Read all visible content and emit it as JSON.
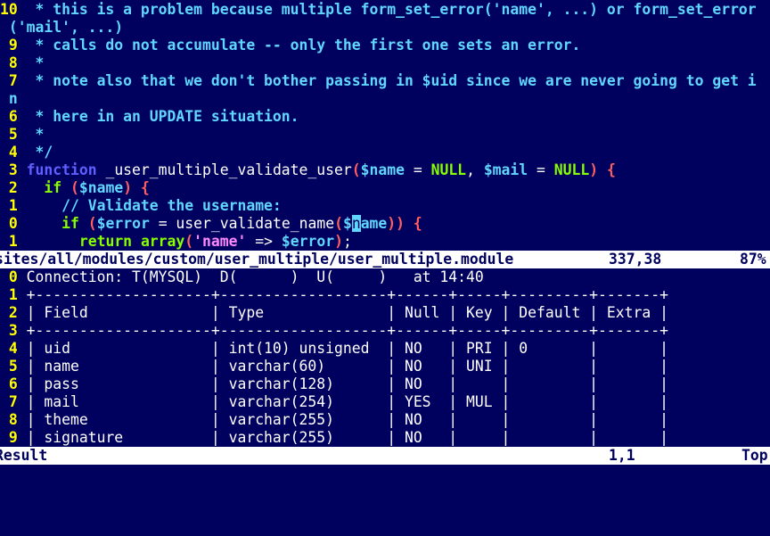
{
  "editor": {
    "lines": [
      {
        "ln": "10",
        "parts": [
          {
            "c": "cm",
            "t": " * this is a problem because multiple form_set_error('name', ...) or form_set_error"
          }
        ]
      },
      {
        "ln": "",
        "parts": [
          {
            "c": "cm",
            "t": "('mail', ...)"
          }
        ]
      },
      {
        "ln": " 9",
        "parts": [
          {
            "c": "cm",
            "t": " * calls do not accumulate -- only the first one sets an error."
          }
        ]
      },
      {
        "ln": " 8",
        "parts": [
          {
            "c": "cm",
            "t": " *"
          }
        ]
      },
      {
        "ln": " 7",
        "parts": [
          {
            "c": "cm",
            "t": " * note also that we don't bother passing in $uid since we are never going to get i"
          }
        ]
      },
      {
        "ln": "",
        "parts": [
          {
            "c": "cm",
            "t": "n"
          }
        ]
      },
      {
        "ln": " 6",
        "parts": [
          {
            "c": "cm",
            "t": " * here in an UPDATE situation."
          }
        ]
      },
      {
        "ln": " 5",
        "parts": [
          {
            "c": "cm",
            "t": " *"
          }
        ]
      },
      {
        "ln": " 4",
        "parts": [
          {
            "c": "cm",
            "t": " */"
          }
        ]
      },
      {
        "ln": " 3",
        "parts": [
          {
            "c": "kw",
            "t": "function"
          },
          {
            "c": "wht",
            "t": " _user_multiple_validate_user"
          },
          {
            "c": "red",
            "t": "("
          },
          {
            "c": "var",
            "t": "$name"
          },
          {
            "c": "wht",
            "t": " = "
          },
          {
            "c": "grn",
            "t": "NULL"
          },
          {
            "c": "wht",
            "t": ", "
          },
          {
            "c": "var",
            "t": "$mail"
          },
          {
            "c": "wht",
            "t": " = "
          },
          {
            "c": "grn",
            "t": "NULL"
          },
          {
            "c": "red",
            "t": ")"
          },
          {
            "c": "wht",
            "t": " "
          },
          {
            "c": "red",
            "t": "{"
          }
        ]
      },
      {
        "ln": " 2",
        "parts": [
          {
            "c": "wht",
            "t": "  "
          },
          {
            "c": "grn",
            "t": "if"
          },
          {
            "c": "wht",
            "t": " "
          },
          {
            "c": "red",
            "t": "("
          },
          {
            "c": "var",
            "t": "$name"
          },
          {
            "c": "red",
            "t": ")"
          },
          {
            "c": "wht",
            "t": " "
          },
          {
            "c": "red",
            "t": "{"
          }
        ]
      },
      {
        "ln": " 1",
        "parts": [
          {
            "c": "cm",
            "t": "    // Validate the username:"
          }
        ]
      },
      {
        "ln": " 0",
        "parts": [
          {
            "c": "wht",
            "t": "    "
          },
          {
            "c": "grn",
            "t": "if"
          },
          {
            "c": "wht",
            "t": " "
          },
          {
            "c": "red",
            "t": "("
          },
          {
            "c": "var",
            "t": "$error"
          },
          {
            "c": "wht",
            "t": " = user_validate_name"
          },
          {
            "c": "red",
            "t": "("
          },
          {
            "c": "var",
            "t": "$"
          },
          {
            "c": "cursor",
            "t": "n"
          },
          {
            "c": "var",
            "t": "ame"
          },
          {
            "c": "red",
            "t": "))"
          },
          {
            "c": "wht",
            "t": " "
          },
          {
            "c": "red",
            "t": "{"
          }
        ]
      },
      {
        "ln": " 1",
        "parts": [
          {
            "c": "wht",
            "t": "      "
          },
          {
            "c": "grn",
            "t": "return"
          },
          {
            "c": "wht",
            "t": " "
          },
          {
            "c": "grn",
            "t": "array"
          },
          {
            "c": "red",
            "t": "("
          },
          {
            "c": "str",
            "t": "'name'"
          },
          {
            "c": "wht",
            "t": " => "
          },
          {
            "c": "var",
            "t": "$error"
          },
          {
            "c": "red",
            "t": ")"
          },
          {
            "c": "wht",
            "t": ";"
          }
        ]
      }
    ],
    "status": {
      "file": "sites/all/modules/custom/user_multiple/user_multiple.module",
      "position": "337,38",
      "percent": "87%"
    }
  },
  "result": {
    "lines": [
      {
        "ln": " 0",
        "text": "Connection: T(MYSQL)  D(      )  U(     )   at 14:40"
      },
      {
        "ln": " 1",
        "text": "+--------------------+-------------------+------+-----+---------+-------+"
      },
      {
        "ln": " 2",
        "text": "| Field              | Type              | Null | Key | Default | Extra |"
      },
      {
        "ln": " 3",
        "text": "+--------------------+-------------------+------+-----+---------+-------+"
      },
      {
        "ln": " 4",
        "text": "| uid                | int(10) unsigned  | NO   | PRI | 0       |       |"
      },
      {
        "ln": " 5",
        "text": "| name               | varchar(60)       | NO   | UNI |         |       |"
      },
      {
        "ln": " 6",
        "text": "| pass               | varchar(128)      | NO   |     |         |       |"
      },
      {
        "ln": " 7",
        "text": "| mail               | varchar(254)      | YES  | MUL |         |       |"
      },
      {
        "ln": " 8",
        "text": "| theme              | varchar(255)      | NO   |     |         |       |"
      },
      {
        "ln": " 9",
        "text": "| signature          | varchar(255)      | NO   |     |         |       |"
      }
    ],
    "status": {
      "name": "Result",
      "position": "1,1",
      "scroll": "Top"
    }
  }
}
